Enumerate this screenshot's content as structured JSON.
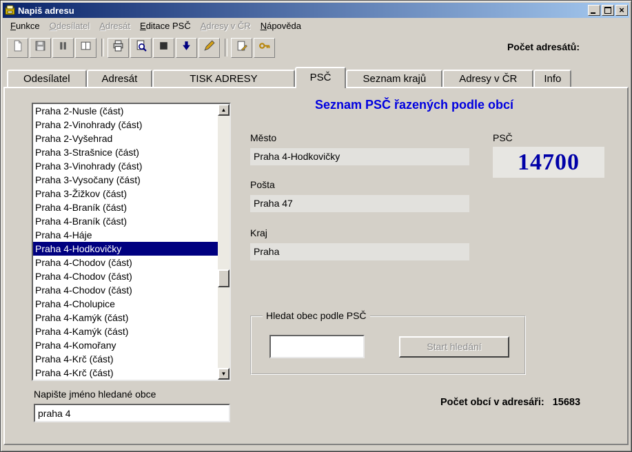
{
  "window": {
    "title": "Napiš adresu",
    "close_glyph": "×"
  },
  "menu": {
    "items": [
      {
        "label": "Funkce",
        "enabled": true
      },
      {
        "label": "Odesílatel",
        "enabled": false
      },
      {
        "label": "Adresát",
        "enabled": false
      },
      {
        "label": "Editace PSČ",
        "enabled": true
      },
      {
        "label": "Adresy v ČR",
        "enabled": false
      },
      {
        "label": "Nápověda",
        "enabled": true
      }
    ]
  },
  "toolbar": {
    "count_label": "Počet adresátů:",
    "groups": [
      [
        "new-document-icon",
        "save-icon",
        "pause-icon",
        "columns-icon"
      ],
      [
        "print-icon",
        "print-preview-icon",
        "stop-icon",
        "down-arrow-icon",
        "pen-icon"
      ],
      [
        "note-icon",
        "key-icon"
      ]
    ]
  },
  "tabs": {
    "active_index": 3,
    "items": [
      "Odesílatel",
      "Adresát",
      "TISK ADRESY",
      "PSČ",
      "Seznam krajů",
      "Adresy v ČR",
      "Info"
    ]
  },
  "list": {
    "selected_index": 10,
    "items": [
      "Praha 2-Nusle (část)",
      "Praha 2-Vinohrady (část)",
      "Praha 2-Vyšehrad",
      "Praha 3-Strašnice (část)",
      "Praha 3-Vinohrady (část)",
      "Praha 3-Vysočany (část)",
      "Praha 3-Žižkov (část)",
      "Praha 4-Braník (část)",
      "Praha 4-Braník (část)",
      "Praha 4-Háje",
      "Praha 4-Hodkovičky",
      "Praha 4-Chodov (část)",
      "Praha 4-Chodov (část)",
      "Praha 4-Chodov (část)",
      "Praha 4-Cholupice",
      "Praha 4-Kamýk (část)",
      "Praha 4-Kamýk (část)",
      "Praha 4-Komořany",
      "Praha 4-Krč (část)",
      "Praha 4-Krč (část)"
    ]
  },
  "scrollbar": {
    "up_glyph": "▲",
    "down_glyph": "▼"
  },
  "search_obce": {
    "label": "Napište jméno hledané obce",
    "value": "praha 4"
  },
  "detail": {
    "heading": "Seznam PSČ řazených podle obcí",
    "mesto_label": "Město",
    "mesto_value": "Praha 4-Hodkovičky",
    "psc_label": "PSČ",
    "psc_value": "14700",
    "posta_label": "Pošta",
    "posta_value": "Praha 47",
    "kraj_label": "Kraj",
    "kraj_value": "Praha",
    "group_title": "Hledat obec podle PSČ",
    "search_button_label": "Start hledání",
    "count_label": "Počet obcí v adresáři:",
    "count_value": "15683"
  }
}
